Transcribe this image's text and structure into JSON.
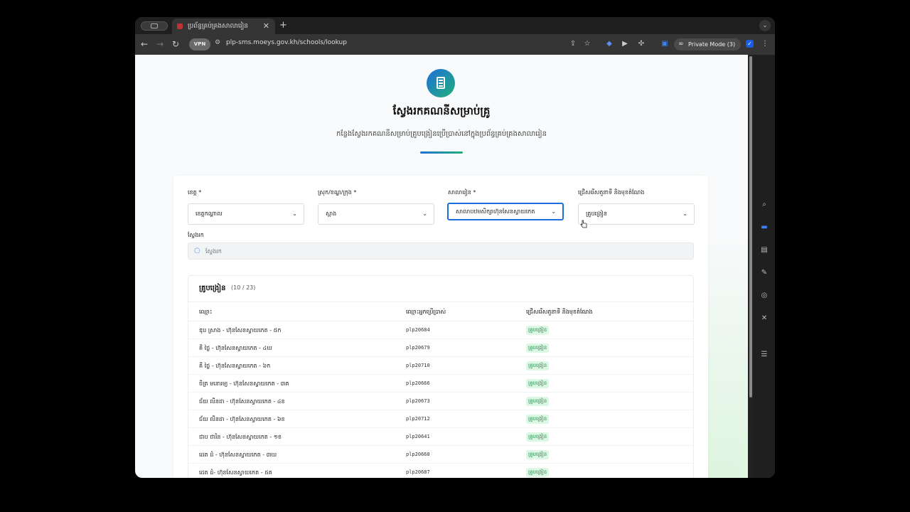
{
  "browser": {
    "tab_title": "ប្រព័ន្ធគ្រប់គ្រងសាលារៀន",
    "tab_close": "✕",
    "new_tab": "+",
    "vpn_label": "VPN",
    "url": "plp-sms.moeys.gov.kh/schools/lookup",
    "private_mode": "Private Mode (3)"
  },
  "page": {
    "title": "ស្វែងរកគណនីសម្រាប់គ្រូ",
    "subtitle": "កន្លែងស្វែងរកគណនីសម្រាប់គ្រូបង្រៀនប្រើប្រាស់នៅក្នុងប្រព័ន្ធគ្រប់គ្រងសាលារៀន"
  },
  "filters": {
    "province": {
      "label": "ខេត្ត *",
      "value": "ខេត្តកណ្ដាល"
    },
    "district": {
      "label": "ស្រុក/ខណ្ឌ/ក្រុង *",
      "value": "ស្អាង"
    },
    "school": {
      "label": "សាលារៀន *",
      "value": "សាលាបឋមសិក្សាហ៊ុនសែនស្វាយកេត"
    },
    "role": {
      "label": "ជ្រើសរើសតួនាទី និងមុខតំណែង",
      "value": "គ្រូបង្រៀន"
    }
  },
  "search": {
    "label": "ស្វែងរក",
    "placeholder": "ស្វែងរក"
  },
  "table": {
    "title": "គ្រូបង្រៀន",
    "count": "(10 / 23)",
    "columns": [
      "ឈ្មោះ",
      "ឈ្មោះអ្នកប្រើប្រាស់",
      "ជ្រើសរើសតួនាទី និងមុខតំណែង"
    ],
    "rows": [
      {
        "name": "ឌុប ស្រាង - ហ៊ុនសែនស្វាយកេត - ៥ក",
        "username": "plp20684",
        "role": "គ្រូបង្រៀន"
      },
      {
        "name": "គី ថ្លៃ - ហ៊ុនសែនស្វាយកេត - ៤ឃ",
        "username": "plp20679",
        "role": "គ្រូបង្រៀន"
      },
      {
        "name": "គី ថ្លៃ - ហ៊ុនសែនស្វាយកេត - ៦ក",
        "username": "plp20710",
        "role": "គ្រូបង្រៀន"
      },
      {
        "name": "ចិត្រ មនោរម្យ - ហ៊ុនសែនស្វាយកេត - ៣គ",
        "username": "plp20666",
        "role": "គ្រូបង្រៀន"
      },
      {
        "name": "ជ័យ លីនដា - ហ៊ុនសែនស្វាយកេត - ៤ខ",
        "username": "plp20673",
        "role": "គ្រូបង្រៀន"
      },
      {
        "name": "ជ័យ លីនដា - ហ៊ុនសែនស្វាយកេត - ៦ខ",
        "username": "plp20712",
        "role": "គ្រូបង្រៀន"
      },
      {
        "name": "ជាប ថារិន - ហ៊ុនសែនស្វាយកេត - ១ខ",
        "username": "plp20641",
        "role": "គ្រូបង្រៀន"
      },
      {
        "name": "ដេត ដំ - ហ៊ុនសែនស្វាយកេត - ៣ឃ",
        "username": "plp20668",
        "role": "គ្រូបង្រៀន"
      },
      {
        "name": "ដេត ដំ- ហ៊ុនសែនស្វាយកេត - ៥គ",
        "username": "plp20687",
        "role": "គ្រូបង្រៀន"
      }
    ]
  },
  "colors": {
    "accent_blue": "#1e6fd9",
    "accent_green": "#21b07a",
    "badge_bg": "#dcf7e3",
    "badge_text": "#1f8a4c"
  }
}
